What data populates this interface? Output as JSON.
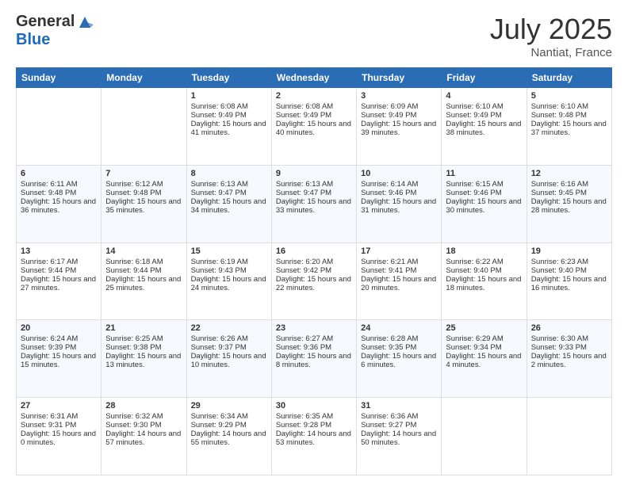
{
  "header": {
    "logo_general": "General",
    "logo_blue": "Blue",
    "month_title": "July 2025",
    "location": "Nantiat, France"
  },
  "days_of_week": [
    "Sunday",
    "Monday",
    "Tuesday",
    "Wednesday",
    "Thursday",
    "Friday",
    "Saturday"
  ],
  "weeks": [
    [
      {
        "day": "",
        "sunrise": "",
        "sunset": "",
        "daylight": ""
      },
      {
        "day": "",
        "sunrise": "",
        "sunset": "",
        "daylight": ""
      },
      {
        "day": "1",
        "sunrise": "Sunrise: 6:08 AM",
        "sunset": "Sunset: 9:49 PM",
        "daylight": "Daylight: 15 hours and 41 minutes."
      },
      {
        "day": "2",
        "sunrise": "Sunrise: 6:08 AM",
        "sunset": "Sunset: 9:49 PM",
        "daylight": "Daylight: 15 hours and 40 minutes."
      },
      {
        "day": "3",
        "sunrise": "Sunrise: 6:09 AM",
        "sunset": "Sunset: 9:49 PM",
        "daylight": "Daylight: 15 hours and 39 minutes."
      },
      {
        "day": "4",
        "sunrise": "Sunrise: 6:10 AM",
        "sunset": "Sunset: 9:49 PM",
        "daylight": "Daylight: 15 hours and 38 minutes."
      },
      {
        "day": "5",
        "sunrise": "Sunrise: 6:10 AM",
        "sunset": "Sunset: 9:48 PM",
        "daylight": "Daylight: 15 hours and 37 minutes."
      }
    ],
    [
      {
        "day": "6",
        "sunrise": "Sunrise: 6:11 AM",
        "sunset": "Sunset: 9:48 PM",
        "daylight": "Daylight: 15 hours and 36 minutes."
      },
      {
        "day": "7",
        "sunrise": "Sunrise: 6:12 AM",
        "sunset": "Sunset: 9:48 PM",
        "daylight": "Daylight: 15 hours and 35 minutes."
      },
      {
        "day": "8",
        "sunrise": "Sunrise: 6:13 AM",
        "sunset": "Sunset: 9:47 PM",
        "daylight": "Daylight: 15 hours and 34 minutes."
      },
      {
        "day": "9",
        "sunrise": "Sunrise: 6:13 AM",
        "sunset": "Sunset: 9:47 PM",
        "daylight": "Daylight: 15 hours and 33 minutes."
      },
      {
        "day": "10",
        "sunrise": "Sunrise: 6:14 AM",
        "sunset": "Sunset: 9:46 PM",
        "daylight": "Daylight: 15 hours and 31 minutes."
      },
      {
        "day": "11",
        "sunrise": "Sunrise: 6:15 AM",
        "sunset": "Sunset: 9:46 PM",
        "daylight": "Daylight: 15 hours and 30 minutes."
      },
      {
        "day": "12",
        "sunrise": "Sunrise: 6:16 AM",
        "sunset": "Sunset: 9:45 PM",
        "daylight": "Daylight: 15 hours and 28 minutes."
      }
    ],
    [
      {
        "day": "13",
        "sunrise": "Sunrise: 6:17 AM",
        "sunset": "Sunset: 9:44 PM",
        "daylight": "Daylight: 15 hours and 27 minutes."
      },
      {
        "day": "14",
        "sunrise": "Sunrise: 6:18 AM",
        "sunset": "Sunset: 9:44 PM",
        "daylight": "Daylight: 15 hours and 25 minutes."
      },
      {
        "day": "15",
        "sunrise": "Sunrise: 6:19 AM",
        "sunset": "Sunset: 9:43 PM",
        "daylight": "Daylight: 15 hours and 24 minutes."
      },
      {
        "day": "16",
        "sunrise": "Sunrise: 6:20 AM",
        "sunset": "Sunset: 9:42 PM",
        "daylight": "Daylight: 15 hours and 22 minutes."
      },
      {
        "day": "17",
        "sunrise": "Sunrise: 6:21 AM",
        "sunset": "Sunset: 9:41 PM",
        "daylight": "Daylight: 15 hours and 20 minutes."
      },
      {
        "day": "18",
        "sunrise": "Sunrise: 6:22 AM",
        "sunset": "Sunset: 9:40 PM",
        "daylight": "Daylight: 15 hours and 18 minutes."
      },
      {
        "day": "19",
        "sunrise": "Sunrise: 6:23 AM",
        "sunset": "Sunset: 9:40 PM",
        "daylight": "Daylight: 15 hours and 16 minutes."
      }
    ],
    [
      {
        "day": "20",
        "sunrise": "Sunrise: 6:24 AM",
        "sunset": "Sunset: 9:39 PM",
        "daylight": "Daylight: 15 hours and 15 minutes."
      },
      {
        "day": "21",
        "sunrise": "Sunrise: 6:25 AM",
        "sunset": "Sunset: 9:38 PM",
        "daylight": "Daylight: 15 hours and 13 minutes."
      },
      {
        "day": "22",
        "sunrise": "Sunrise: 6:26 AM",
        "sunset": "Sunset: 9:37 PM",
        "daylight": "Daylight: 15 hours and 10 minutes."
      },
      {
        "day": "23",
        "sunrise": "Sunrise: 6:27 AM",
        "sunset": "Sunset: 9:36 PM",
        "daylight": "Daylight: 15 hours and 8 minutes."
      },
      {
        "day": "24",
        "sunrise": "Sunrise: 6:28 AM",
        "sunset": "Sunset: 9:35 PM",
        "daylight": "Daylight: 15 hours and 6 minutes."
      },
      {
        "day": "25",
        "sunrise": "Sunrise: 6:29 AM",
        "sunset": "Sunset: 9:34 PM",
        "daylight": "Daylight: 15 hours and 4 minutes."
      },
      {
        "day": "26",
        "sunrise": "Sunrise: 6:30 AM",
        "sunset": "Sunset: 9:33 PM",
        "daylight": "Daylight: 15 hours and 2 minutes."
      }
    ],
    [
      {
        "day": "27",
        "sunrise": "Sunrise: 6:31 AM",
        "sunset": "Sunset: 9:31 PM",
        "daylight": "Daylight: 15 hours and 0 minutes."
      },
      {
        "day": "28",
        "sunrise": "Sunrise: 6:32 AM",
        "sunset": "Sunset: 9:30 PM",
        "daylight": "Daylight: 14 hours and 57 minutes."
      },
      {
        "day": "29",
        "sunrise": "Sunrise: 6:34 AM",
        "sunset": "Sunset: 9:29 PM",
        "daylight": "Daylight: 14 hours and 55 minutes."
      },
      {
        "day": "30",
        "sunrise": "Sunrise: 6:35 AM",
        "sunset": "Sunset: 9:28 PM",
        "daylight": "Daylight: 14 hours and 53 minutes."
      },
      {
        "day": "31",
        "sunrise": "Sunrise: 6:36 AM",
        "sunset": "Sunset: 9:27 PM",
        "daylight": "Daylight: 14 hours and 50 minutes."
      },
      {
        "day": "",
        "sunrise": "",
        "sunset": "",
        "daylight": ""
      },
      {
        "day": "",
        "sunrise": "",
        "sunset": "",
        "daylight": ""
      }
    ]
  ]
}
